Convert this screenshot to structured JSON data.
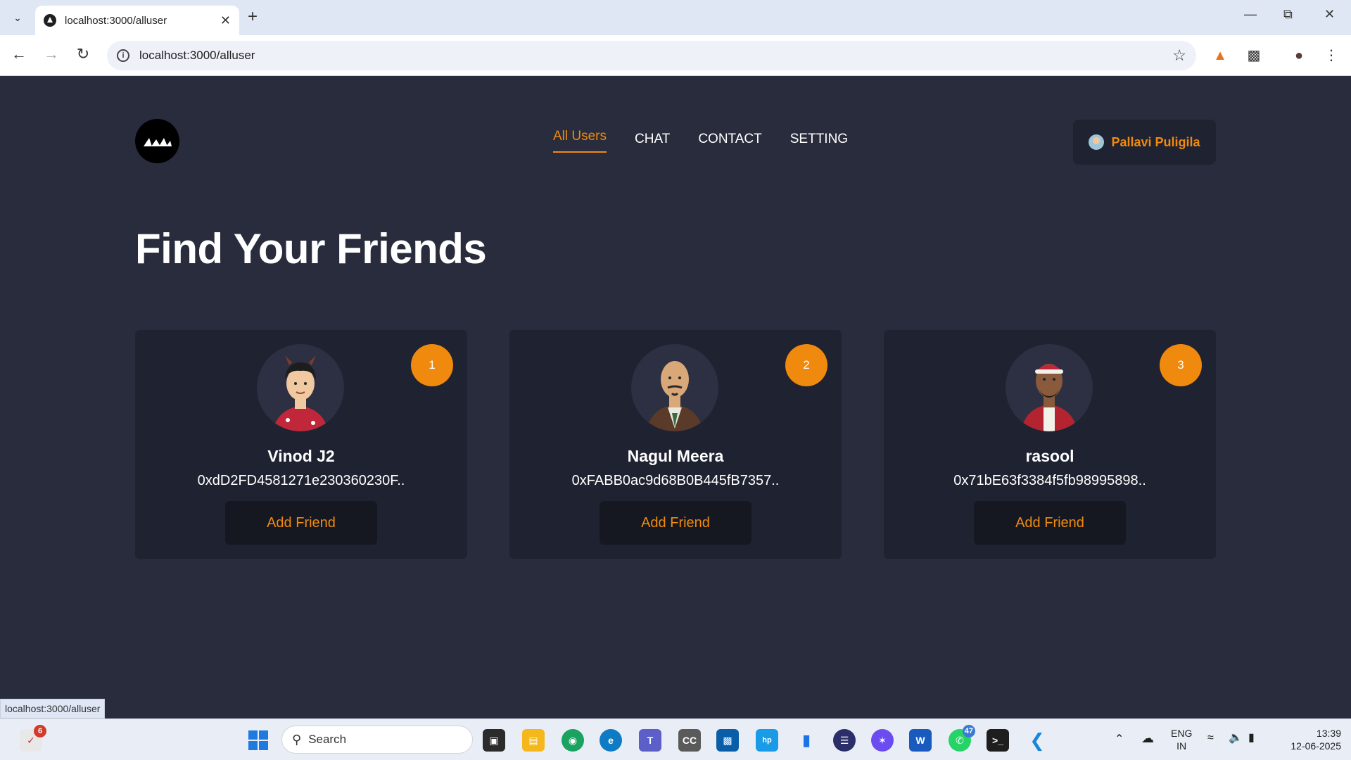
{
  "browser": {
    "tab_title": "localhost:3000/alluser",
    "url": "localhost:3000/alluser",
    "status_url": "localhost:3000/alluser"
  },
  "nav": {
    "items": [
      {
        "label": "All Users",
        "active": true
      },
      {
        "label": "CHAT",
        "active": false
      },
      {
        "label": "CONTACT",
        "active": false
      },
      {
        "label": "SETTING",
        "active": false
      }
    ],
    "account_name": "Pallavi Puligila"
  },
  "page": {
    "heading": "Find Your Friends"
  },
  "cards": [
    {
      "index": "1",
      "name": "Vinod J2",
      "address": "0xdD2FD4581271e230360230F..",
      "button": "Add Friend",
      "avatar": "avatar-red-sweater-icon"
    },
    {
      "index": "2",
      "name": "Nagul Meera",
      "address": "0xFABB0ac9d68B0B445fB7357..",
      "button": "Add Friend",
      "avatar": "avatar-bald-man-icon"
    },
    {
      "index": "3",
      "name": "rasool",
      "address": "0x71bE63f3384f5fb98995898..",
      "button": "Add Friend",
      "avatar": "avatar-bearded-santa-hat-icon"
    }
  ],
  "taskbar": {
    "search_placeholder": "Search",
    "notification_count": "6",
    "whatsapp_count": "47",
    "lang_line1": "ENG",
    "lang_line2": "IN",
    "time": "13:39",
    "date": "12-06-2025"
  },
  "colors": {
    "accent": "#f08a0e",
    "page_bg": "#282c3c",
    "card_bg": "#1f2230"
  }
}
